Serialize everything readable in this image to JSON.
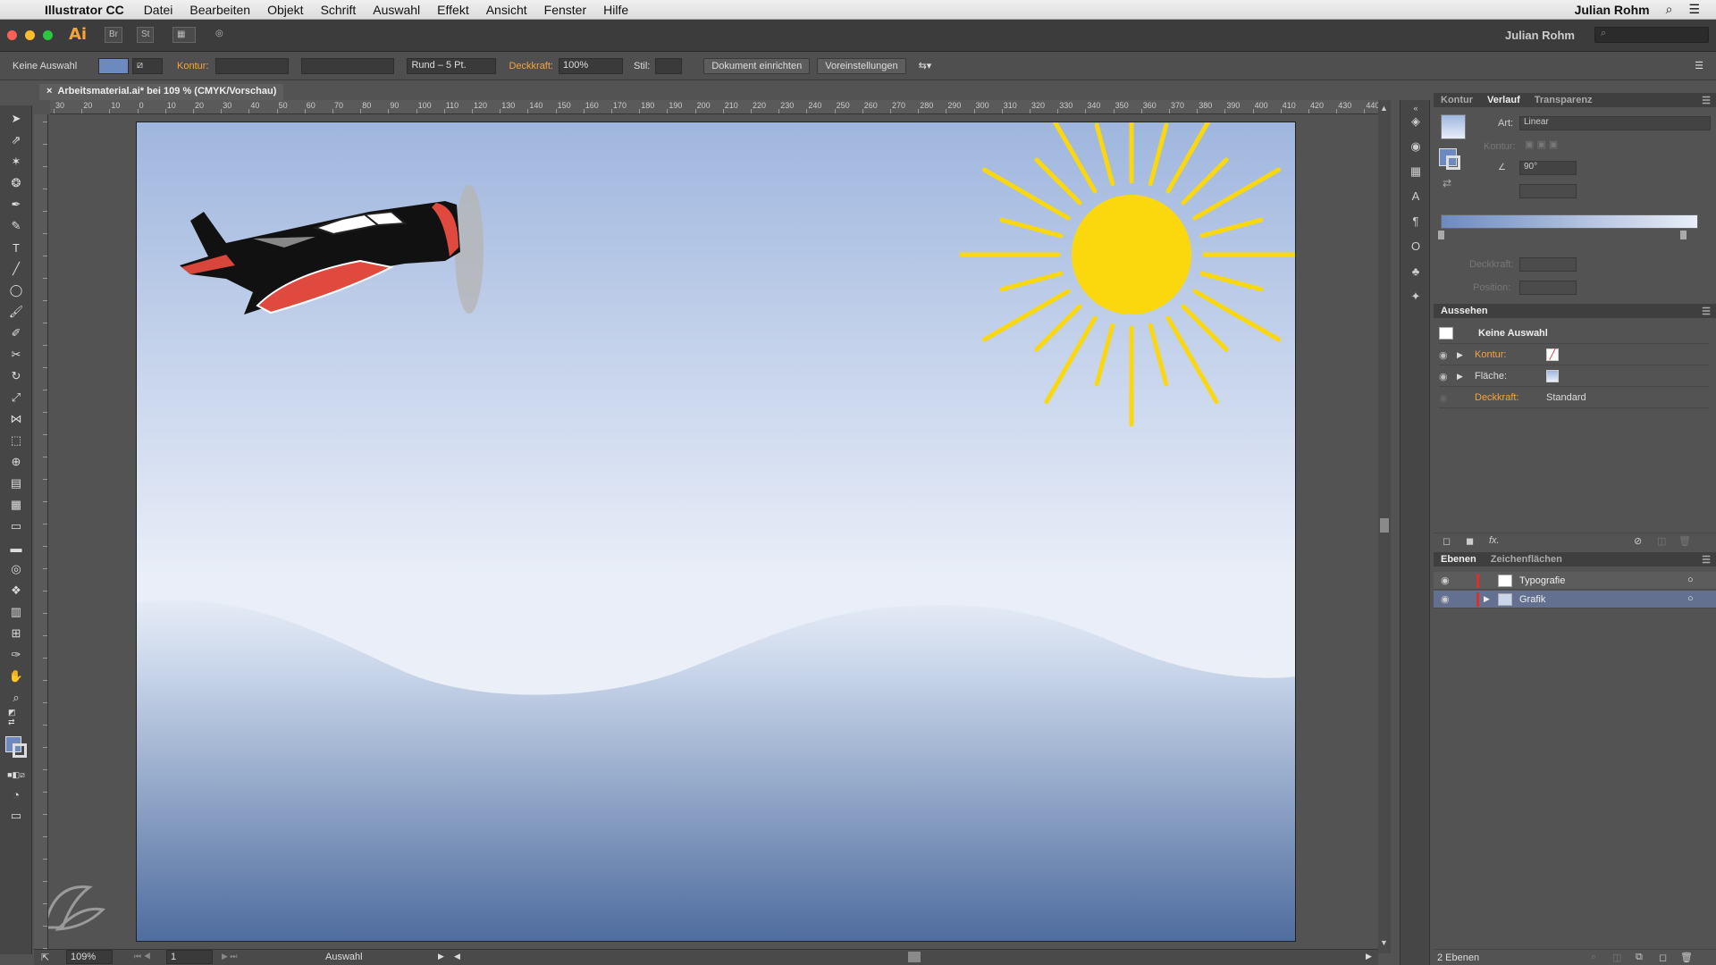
{
  "menubar": {
    "app_name": "Illustrator CC",
    "items": [
      "Datei",
      "Bearbeiten",
      "Objekt",
      "Schrift",
      "Auswahl",
      "Effekt",
      "Ansicht",
      "Fenster",
      "Hilfe"
    ],
    "user": "Julian Rohm"
  },
  "appbar": {
    "logo": "Ai",
    "bridge": "Br",
    "stock": "St",
    "user": "Julian Rohm",
    "search_placeholder": "⌕"
  },
  "controlbar": {
    "selection": "Keine Auswahl",
    "kontur_label": "Kontur:",
    "brush": "Rund – 5 Pt.",
    "opacity_label": "Deckkraft:",
    "opacity_value": "100%",
    "style_label": "Stil:",
    "doc_setup": "Dokument einrichten",
    "preferences": "Voreinstellungen"
  },
  "document": {
    "tab_title": "Arbeitsmaterial.ai* bei 109 % (CMYK/Vorschau)",
    "colors": {
      "sky_top": "#9fb6de",
      "sky_mid": "#e9eef8",
      "ground_bottom": "#4e6c9e",
      "sun": "#fbd80e"
    }
  },
  "ruler_top": [
    "30",
    "20",
    "10",
    "0",
    "10",
    "20",
    "30",
    "40",
    "50",
    "60",
    "70",
    "80",
    "90",
    "100",
    "110",
    "120",
    "130",
    "140",
    "150",
    "160",
    "170",
    "180",
    "190",
    "200",
    "210",
    "220",
    "230",
    "240",
    "250",
    "260",
    "270",
    "280",
    "290",
    "300",
    "310",
    "320",
    "330",
    "340",
    "350",
    "360",
    "370",
    "380",
    "390",
    "400",
    "410",
    "420",
    "430",
    "440"
  ],
  "status": {
    "zoom": "109%",
    "page": "1",
    "tool": "Auswahl"
  },
  "panel_gradient": {
    "tabs": [
      "Kontur",
      "Verlauf",
      "Transparenz"
    ],
    "type_label": "Art:",
    "type_value": "Linear",
    "kontur_label": "Kontur:",
    "angle_value": "90°",
    "opacity_label": "Deckkraft:",
    "position_label": "Position:"
  },
  "panel_appearance": {
    "title": "Aussehen",
    "header": "Keine Auswahl",
    "rows": [
      {
        "label": "Kontur:",
        "orange": true,
        "value": ""
      },
      {
        "label": "Fläche:",
        "orange": false,
        "value": ""
      },
      {
        "label": "Deckkraft:",
        "orange": true,
        "value": "Standard"
      }
    ],
    "fx": "fx."
  },
  "panel_layers": {
    "tabs": [
      "Ebenen",
      "Zeichenflächen"
    ],
    "layers": [
      {
        "name": "Typografie"
      },
      {
        "name": "Grafik"
      }
    ],
    "count": "2 Ebenen"
  }
}
